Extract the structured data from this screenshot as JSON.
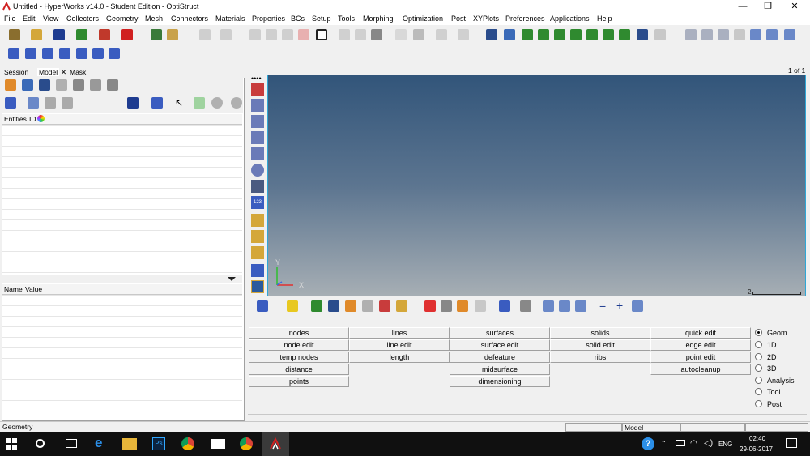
{
  "window": {
    "title": "Untitled - HyperWorks v14.0 - Student Edition - OptiStruct",
    "controls": {
      "minimize": "—",
      "maximize": "❐",
      "close": "✕"
    }
  },
  "menu": [
    "File",
    "Edit",
    "View",
    "Collectors",
    "Geometry",
    "Mesh",
    "Connectors",
    "Materials",
    "Properties",
    "BCs",
    "Setup",
    "Tools",
    "Morphing",
    "Optimization",
    "Post",
    "XYPlots",
    "Preferences",
    "Applications",
    "Help"
  ],
  "page_indicator": "1 of 1",
  "left_panel": {
    "tabs": [
      "Session",
      "Model",
      "Mask"
    ],
    "tab_close": "✕",
    "entity_header": {
      "col1": "Entities",
      "col2": "ID"
    },
    "props_header": {
      "col1": "Name",
      "col2": "Value"
    }
  },
  "viewport": {
    "axis_y": "Y",
    "axis_x": "X",
    "scale_label": "2"
  },
  "panel_buttons": {
    "col1": [
      "nodes",
      "node edit",
      "temp nodes",
      "distance",
      "points"
    ],
    "col2": [
      "lines",
      "line edit",
      "length"
    ],
    "col3": [
      "surfaces",
      "surface edit",
      "defeature",
      "midsurface",
      "dimensioning"
    ],
    "col4": [
      "solids",
      "solid edit",
      "ribs"
    ],
    "col5": [
      "quick edit",
      "edge edit",
      "point edit",
      "autocleanup"
    ]
  },
  "page_radio": {
    "options": [
      "Geom",
      "1D",
      "2D",
      "3D",
      "Analysis",
      "Tool",
      "Post"
    ],
    "selected": "Geom"
  },
  "status_bar": {
    "left": "Geometry",
    "model": "Model"
  },
  "taskbar": {
    "language": "ENG",
    "time": "02:40",
    "date": "29-06-2017",
    "photoshop": "Ps",
    "help": "?"
  },
  "colors": {
    "viewport_top": "#32557a",
    "viewport_bottom": "#a6aeb4",
    "viewport_border": "#2fa7d6",
    "taskbar": "#101010"
  }
}
